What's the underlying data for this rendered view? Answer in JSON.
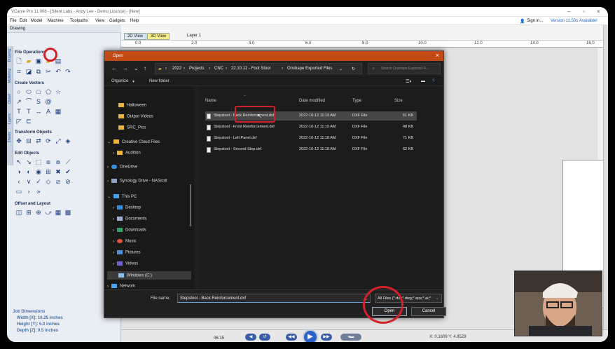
{
  "app": {
    "title": "VCarve Pro 11.008 - [Silent Labs - Andy Lee - Demo Licence] - [New]",
    "menus": [
      "File",
      "Edit",
      "Model",
      "Machine",
      "Toolpaths",
      "View",
      "Gadgets",
      "Help"
    ],
    "sign_in": "Sign in...",
    "version_notice": "Version 11.501 Available!"
  },
  "left_panel": {
    "header": "Drawing",
    "side_tabs": [
      "Drawing",
      "Modeling",
      "Clipart",
      "Layers",
      "Sheets"
    ],
    "sections": [
      "File Operations",
      "Create Vectors",
      "Transform Objects",
      "Edit Objects",
      "Offset and Layout"
    ],
    "job_dimensions": {
      "title": "Job Dimensions",
      "width": "Width  [X]: 16.25 inches",
      "height": "Height [Y]: 5.0 inches",
      "depth": "Depth  [Z]: 0.5 inches"
    }
  },
  "view_tabs": {
    "tab_2d": "2D View",
    "tab_3d": "3D View"
  },
  "layer_label": "Layer 1",
  "ruler_ticks": [
    "0.0",
    "2.0",
    "4.0",
    "6.0",
    "8.0",
    "10.0",
    "12.0",
    "14.0",
    "16.0"
  ],
  "status": {
    "coords": "X: 0.1609 Y: 4.8529",
    "video_time": "06:15"
  },
  "dialog": {
    "title": "Open",
    "breadcrumb": [
      "2022",
      "Projects",
      "CNC",
      "22.10.12 - Foot Stool",
      "Onshape Exported Files"
    ],
    "search_placeholder": "Search Onshape Exported Fi...",
    "organize": "Organize",
    "new_folder": "New folder",
    "nav_items": [
      {
        "label": "Halloween",
        "icon": "folder-icon"
      },
      {
        "label": "Output Videos",
        "icon": "folder-icon"
      },
      {
        "label": "SRC_Pics",
        "icon": "folder-icon"
      },
      {
        "label": "Creative Cloud Files",
        "icon": "creative-cloud-icon"
      },
      {
        "label": "Audition",
        "icon": "folder-icon"
      },
      {
        "label": "OneDrive",
        "icon": "cloud-icon"
      },
      {
        "label": "Synology Drive - NAScott",
        "icon": "drive-icon"
      },
      {
        "label": "This PC",
        "icon": "computer-icon"
      },
      {
        "label": "Desktop",
        "icon": "desktop-icon"
      },
      {
        "label": "Documents",
        "icon": "documents-icon"
      },
      {
        "label": "Downloads",
        "icon": "downloads-icon"
      },
      {
        "label": "Music",
        "icon": "music-icon"
      },
      {
        "label": "Pictures",
        "icon": "pictures-icon"
      },
      {
        "label": "Videos",
        "icon": "videos-icon"
      },
      {
        "label": "Windows (C:)",
        "icon": "disk-icon"
      },
      {
        "label": "Network",
        "icon": "network-icon"
      }
    ],
    "columns": [
      "Name",
      "Date modified",
      "Type",
      "Size"
    ],
    "files": [
      {
        "name": "Stepstool - Back Reinforcement.dxf",
        "date": "2022-10-12 11:19 AM",
        "type": "DXF File",
        "size": "51 KB"
      },
      {
        "name": "Stepstool - Front Reinforcement.dxf",
        "date": "2022-10-12 11:19 AM",
        "type": "DXF File",
        "size": "48 KB"
      },
      {
        "name": "Stepstool - Left Panel.dxf",
        "date": "2022-10-12 11:18 AM",
        "type": "DXF File",
        "size": "71 KB"
      },
      {
        "name": "Stepstool - Second Step.dxf",
        "date": "2022-10-12 11:18 AM",
        "type": "DXF File",
        "size": "62 KB"
      }
    ],
    "file_name_label": "File name:",
    "file_name_value": "Stepstool - Back Reinforcement.dxf",
    "filter_value": "All Files (*.dxf;*.dwg;*.eps;*.ai;*",
    "open_label": "Open",
    "cancel_label": "Cancel"
  },
  "colors": {
    "dialog_title": "#c24a14",
    "annotation": "#d4202b",
    "accent": "#2f62c8"
  }
}
